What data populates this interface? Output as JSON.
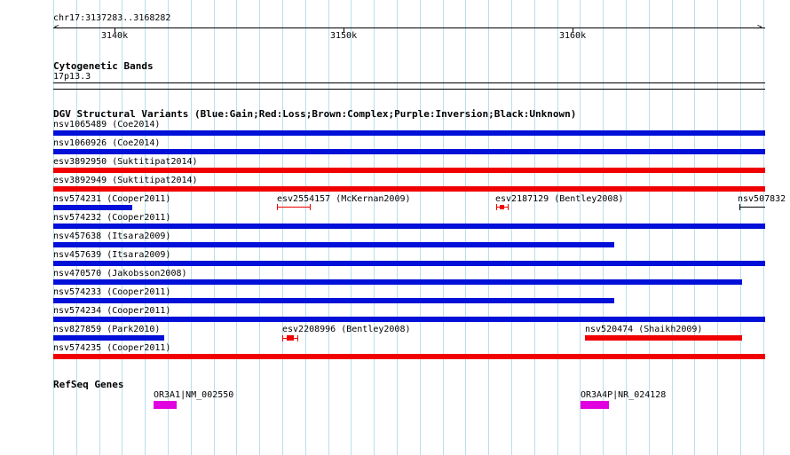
{
  "colors": {
    "grid": "#b9dfeb",
    "gain": "#0010d8",
    "loss": "#f00000",
    "gene": "#e000e0",
    "unknown": "#000000"
  },
  "ruler": {
    "range_label": "chr17:3137283..3168282",
    "tick_labels": [
      "3140k",
      "3150k",
      "3160k"
    ]
  },
  "cytobands": {
    "title": "Cytogenetic Bands",
    "band": "17p13.3"
  },
  "dgv": {
    "title": "DGV Structural Variants (Blue:Gain;Red:Loss;Brown:Complex;Purple:Inversion;Black:Unknown)",
    "variants": [
      {
        "label": "nsv1065489 (Coe2014)",
        "type": "gain"
      },
      {
        "label": "nsv1060926 (Coe2014)",
        "type": "gain"
      },
      {
        "label": "esv3892950 (Suktitipat2014)",
        "type": "loss"
      },
      {
        "label": "esv3892949 (Suktitipat2014)",
        "type": "loss"
      },
      {
        "label": "nsv574231 (Cooper2011)",
        "type": "gain"
      },
      {
        "label": "esv2554157 (McKernan2009)",
        "type": "loss"
      },
      {
        "label": "esv2187129 (Bentley2008)",
        "type": "loss"
      },
      {
        "label": "nsv507832",
        "type": "unknown"
      },
      {
        "label": "nsv574232 (Cooper2011)",
        "type": "gain"
      },
      {
        "label": "nsv457638 (Itsara2009)",
        "type": "gain"
      },
      {
        "label": "nsv457639 (Itsara2009)",
        "type": "gain"
      },
      {
        "label": "nsv470570 (Jakobsson2008)",
        "type": "gain"
      },
      {
        "label": "nsv574233 (Cooper2011)",
        "type": "gain"
      },
      {
        "label": "nsv574234 (Cooper2011)",
        "type": "gain"
      },
      {
        "label": "nsv827859 (Park2010)",
        "type": "gain"
      },
      {
        "label": "esv2208996 (Bentley2008)",
        "type": "loss"
      },
      {
        "label": "nsv520474 (Shaikh2009)",
        "type": "loss"
      },
      {
        "label": "nsv574235 (Cooper2011)",
        "type": "loss"
      }
    ]
  },
  "refseq": {
    "title": "RefSeq Genes",
    "genes": [
      {
        "label": "OR3A1|NM_002550"
      },
      {
        "label": "OR3A4P|NR_024128"
      }
    ]
  }
}
